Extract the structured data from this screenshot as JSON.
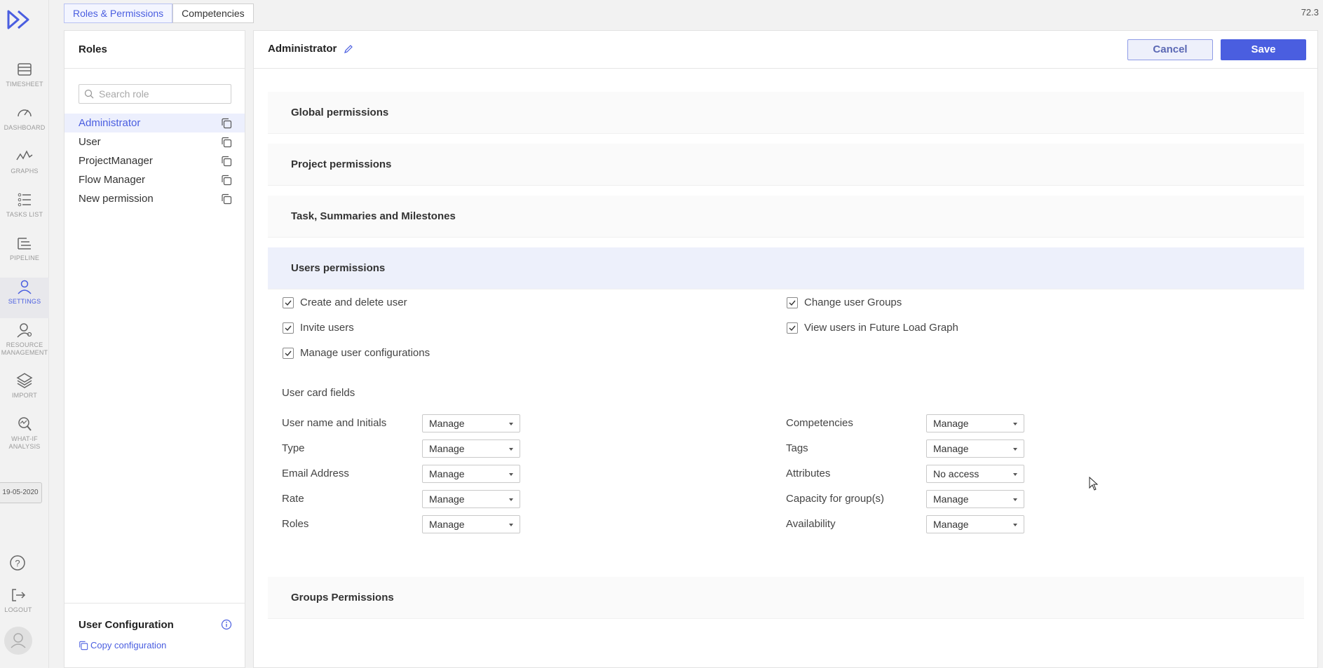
{
  "app": {
    "version": "72.3",
    "nav": [
      {
        "key": "timesheet",
        "label": "TIMESHEET",
        "icon": "timesheet-icon"
      },
      {
        "key": "dashboard",
        "label": "DASHBOARD",
        "icon": "dashboard-icon"
      },
      {
        "key": "graphs",
        "label": "GRAPHS",
        "icon": "graphs-icon"
      },
      {
        "key": "tasks",
        "label": "TASKS LIST",
        "icon": "tasks-list-icon"
      },
      {
        "key": "pipeline",
        "label": "PIPELINE",
        "icon": "pipeline-icon"
      },
      {
        "key": "settings",
        "label": "SETTINGS",
        "icon": "user-icon"
      },
      {
        "key": "resource",
        "label": "RESOURCE",
        "label2": "MANAGEMENT",
        "icon": "resource-management-icon"
      },
      {
        "key": "import",
        "label": "IMPORT",
        "icon": "layers-icon"
      },
      {
        "key": "whatif",
        "label": "WHAT-IF",
        "label2": "ANALYSIS",
        "icon": "what-if-analysis-icon"
      }
    ],
    "date": "19-05-2020",
    "logout_label": "LOGOUT",
    "accent": "#4a5ee0"
  },
  "tabs": [
    {
      "label": "Roles & Permissions",
      "active": true
    },
    {
      "label": "Competencies",
      "active": false
    }
  ],
  "roles": {
    "title": "Roles",
    "search_placeholder": "Search role",
    "items": [
      {
        "label": "Administrator",
        "active": true
      },
      {
        "label": "User"
      },
      {
        "label": "ProjectManager"
      },
      {
        "label": "Flow Manager"
      },
      {
        "label": "New permission"
      }
    ],
    "footer_title": "User Configuration",
    "copy_config_label": "Copy configuration"
  },
  "main": {
    "role_name": "Administrator",
    "cancel_label": "Cancel",
    "save_label": "Save",
    "sections": [
      {
        "label": "Global permissions"
      },
      {
        "label": "Project permissions"
      },
      {
        "label": "Task, Summaries and Milestones"
      },
      {
        "label": "Users permissions",
        "open": true
      },
      {
        "label": "Groups Permissions"
      }
    ],
    "user_permissions": [
      {
        "label": "Create and delete user",
        "checked": true
      },
      {
        "label": "Invite users",
        "checked": true
      },
      {
        "label": "Manage user configurations",
        "checked": true
      },
      {
        "label": "Change user Groups",
        "checked": true
      },
      {
        "label": "View users in Future Load Graph",
        "checked": true
      }
    ],
    "card_fields_title": "User card fields",
    "card_fields_left": [
      {
        "label": "User name and Initials",
        "value": "Manage"
      },
      {
        "label": "Type",
        "value": "Manage"
      },
      {
        "label": "Email Address",
        "value": "Manage"
      },
      {
        "label": "Rate",
        "value": "Manage"
      },
      {
        "label": "Roles",
        "value": "Manage"
      }
    ],
    "card_fields_right": [
      {
        "label": "Competencies",
        "value": "Manage"
      },
      {
        "label": "Tags",
        "value": "Manage"
      },
      {
        "label": "Attributes",
        "value": "No access"
      },
      {
        "label": "Capacity for group(s)",
        "value": "Manage"
      },
      {
        "label": "Availability",
        "value": "Manage"
      }
    ]
  }
}
